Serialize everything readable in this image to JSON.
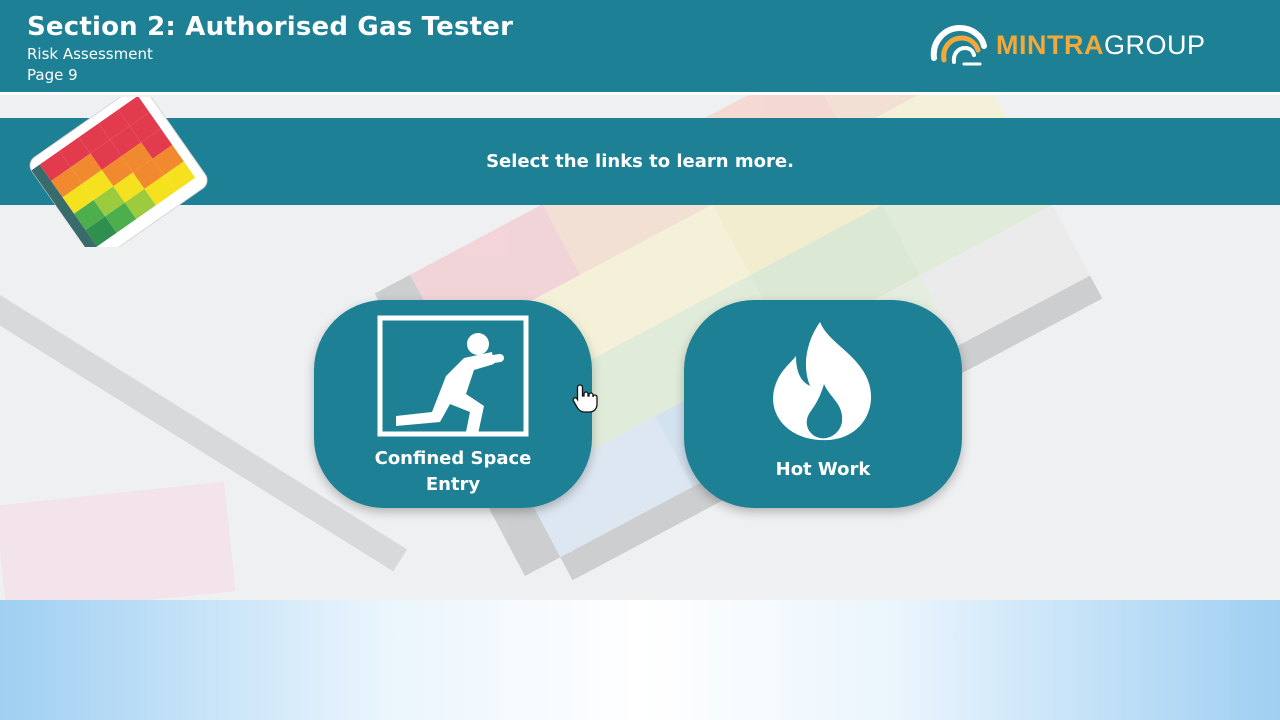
{
  "header": {
    "title": "Section 2: Authorised Gas Tester",
    "subtitle": "Risk Assessment",
    "page": "Page 9"
  },
  "logo": {
    "brand_part1": "MINTRA",
    "brand_part2": "GROUP",
    "icon": "mintra-swirl-icon"
  },
  "banner": {
    "instruction": "Select the links to learn more.",
    "icon": "risk-matrix-icon"
  },
  "links": [
    {
      "label_line1": "Confined Space",
      "label_line2": "Entry",
      "icon": "confined-space-icon"
    },
    {
      "label": "Hot Work",
      "icon": "flame-icon"
    }
  ],
  "colors": {
    "primary": "#1e8095",
    "brand_orange": "#f3a83a",
    "text_light": "#ffffff"
  }
}
